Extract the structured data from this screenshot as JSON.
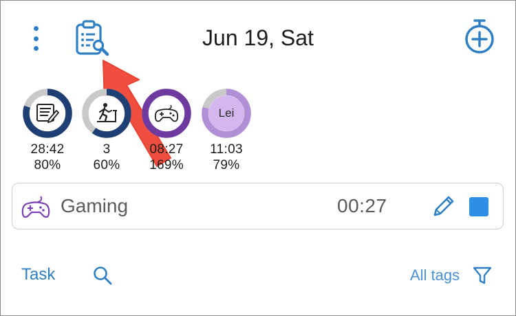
{
  "header": {
    "date_title": "Jun 19, Sat"
  },
  "colors": {
    "accent": "#2f7fc4",
    "navy": "#1d3f73",
    "purple": "#6f3aa0",
    "lilac": "#b08fd6",
    "ring_track": "#c9c9c9",
    "arrow": "#f04e3e",
    "stop": "#2d8ee6"
  },
  "activities": [
    {
      "icon": "notebook-icon",
      "time": "28:42",
      "percent": "80%",
      "progress": 0.8
    },
    {
      "icon": "treadmill-icon",
      "time": "3",
      "percent": "60%",
      "progress": 0.6
    },
    {
      "icon": "gamepad-icon",
      "time": "08:27",
      "percent": "169%",
      "progress": 1.0
    },
    {
      "icon": "avatar-text",
      "label": "Lei",
      "time": "11:03",
      "percent": "79%",
      "progress": 0.79
    }
  ],
  "current": {
    "name": "Gaming",
    "elapsed": "00:27"
  },
  "bottom": {
    "tab_label": "Task",
    "tags_label": "All tags"
  }
}
